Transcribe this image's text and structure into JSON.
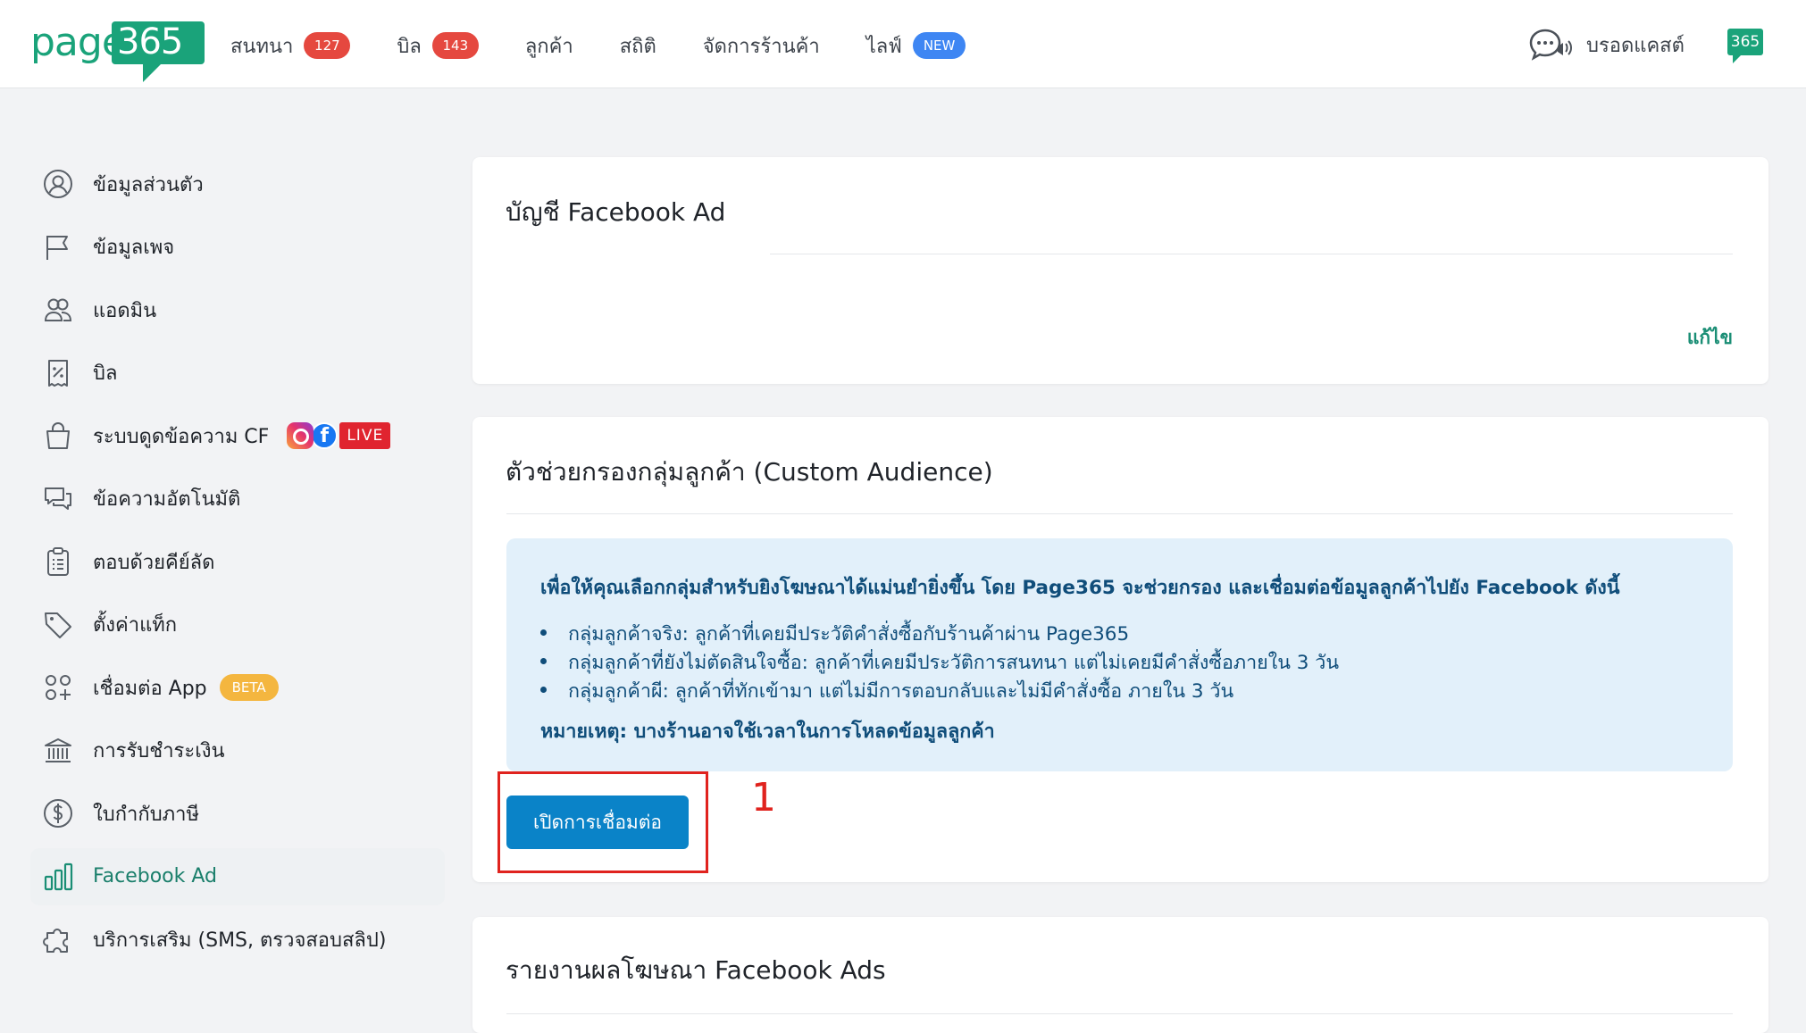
{
  "brand": {
    "logo_word": "page",
    "logo_box": "365",
    "mini_logo": "365",
    "color": "#1aa37a"
  },
  "nav": {
    "items": [
      {
        "label": "สนทนา",
        "badge": "127"
      },
      {
        "label": "บิล",
        "badge": "143"
      },
      {
        "label": "ลูกค้า"
      },
      {
        "label": "สถิติ"
      },
      {
        "label": "จัดการร้านค้า"
      },
      {
        "label": "ไลฟ์",
        "badge": "NEW"
      }
    ],
    "broadcast_label": "บรอดแคสต์"
  },
  "sidebar": {
    "items": [
      {
        "label": "ข้อมูลส่วนตัว",
        "icon": "user-circle-icon"
      },
      {
        "label": "ข้อมูลเพจ",
        "icon": "flag-icon"
      },
      {
        "label": "แอดมิน",
        "icon": "users-icon"
      },
      {
        "label": "บิล",
        "icon": "receipt-icon"
      },
      {
        "label": "ระบบดูดข้อความ CF",
        "icon": "shopping-bag-icon",
        "tag": "LIVE"
      },
      {
        "label": "ข้อความอัตโนมัติ",
        "icon": "chat-bubbles-icon"
      },
      {
        "label": "ตอบด้วยคีย์ลัด",
        "icon": "clipboard-icon"
      },
      {
        "label": "ตั้งค่าแท็ก",
        "icon": "tag-icon"
      },
      {
        "label": "เชื่อมต่อ App",
        "icon": "apps-icon",
        "tag": "BETA"
      },
      {
        "label": "การรับชำระเงิน",
        "icon": "bank-icon"
      },
      {
        "label": "ใบกำกับภาษี",
        "icon": "dollar-circle-icon"
      },
      {
        "label": "Facebook Ad",
        "icon": "bar-chart-icon",
        "active": true
      },
      {
        "label": "บริการเสริม (SMS, ตรวจสอบสลิป)",
        "icon": "puzzle-icon"
      }
    ]
  },
  "ad_account_card": {
    "title": "บัญชี Facebook Ad",
    "edit_label": "แก้ไข"
  },
  "custom_audience_card": {
    "title": "ตัวช่วยกรองกลุ่มลูกค้า (Custom Audience)",
    "info_head": "เพื่อให้คุณเลือกกลุ่มสำหรับยิงโฆษณาได้แม่นยำยิ่งขึ้น โดย Page365 จะช่วยกรอง และเชื่อมต่อข้อมูลลูกค้าไปยัง Facebook ดังนี้",
    "bullets": [
      "กลุ่มลูกค้าจริง: ลูกค้าที่เคยมีประวัติคำสั่งซื้อกับร้านค้าผ่าน Page365",
      "กลุ่มลูกค้าที่ยังไม่ตัดสินใจซื้อ: ลูกค้าที่เคยมีประวัติการสนทนา แต่ไม่เคยมีคำสั่งซื้อภายใน 3 วัน",
      "กลุ่มลูกค้าผี: ลูกค้าที่ทักเข้ามา แต่ไม่มีการตอบกลับและไม่มีคำสั่งซื้อ ภายใน 3 วัน"
    ],
    "note": "หมายเหตุ: บางร้านอาจใช้เวลาในการโหลดข้อมูลลูกค้า",
    "connect_button": "เปิดการเชื่อมต่อ"
  },
  "annotation": {
    "step_number": "1",
    "color": "#e0231e"
  },
  "report_card": {
    "title": "รายงานผลโฆษณา Facebook Ads"
  }
}
